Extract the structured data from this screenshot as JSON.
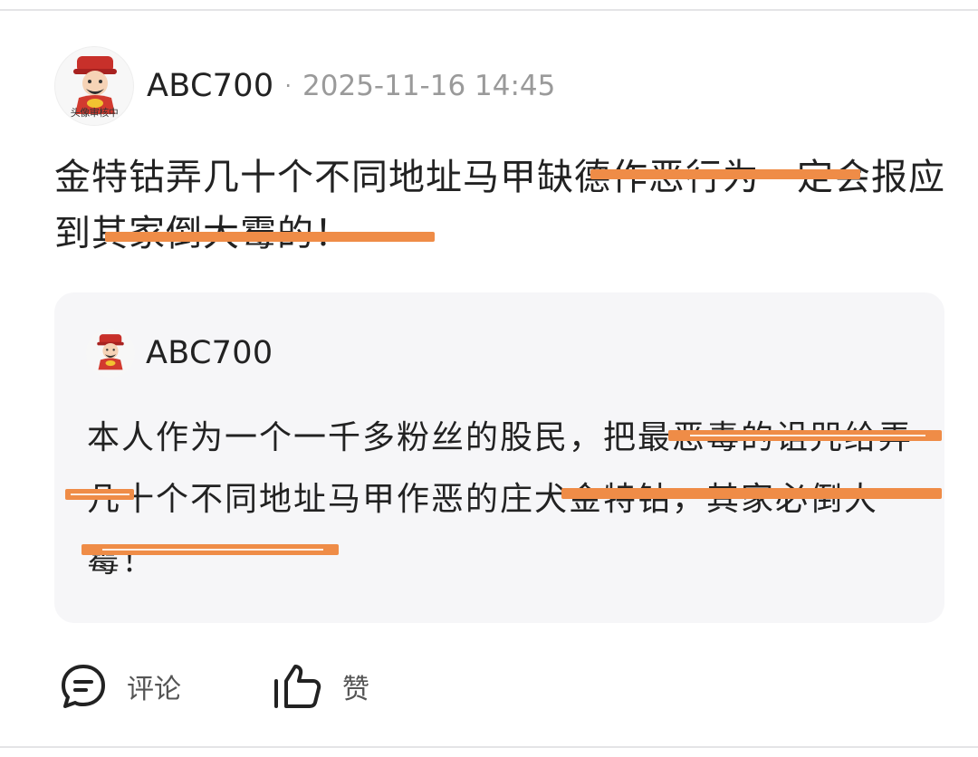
{
  "post": {
    "author": "ABC700",
    "separator": "·",
    "timestamp": "2025-11-16 14:45",
    "avatar_caption": "头像审核中",
    "body": "金特钴弄几十个不同地址马甲缺德作恶行为一定会报应到其家倒大霉的！"
  },
  "quoted": {
    "author": "ABC700",
    "body": "本人作为一个一千多粉丝的股民，把最恶毒的诅咒给弄几十个不同地址马甲作恶的庄犬金特钴，其家必倒大霉！"
  },
  "actions": {
    "comment_label": "评论",
    "like_label": "赞"
  },
  "colors": {
    "redaction": "#ef8c47",
    "quote_background": "#f6f6f8",
    "muted_text": "#9a9a9a"
  },
  "icons": {
    "comment": "comment-bubble-icon",
    "like": "thumbs-up-icon"
  }
}
